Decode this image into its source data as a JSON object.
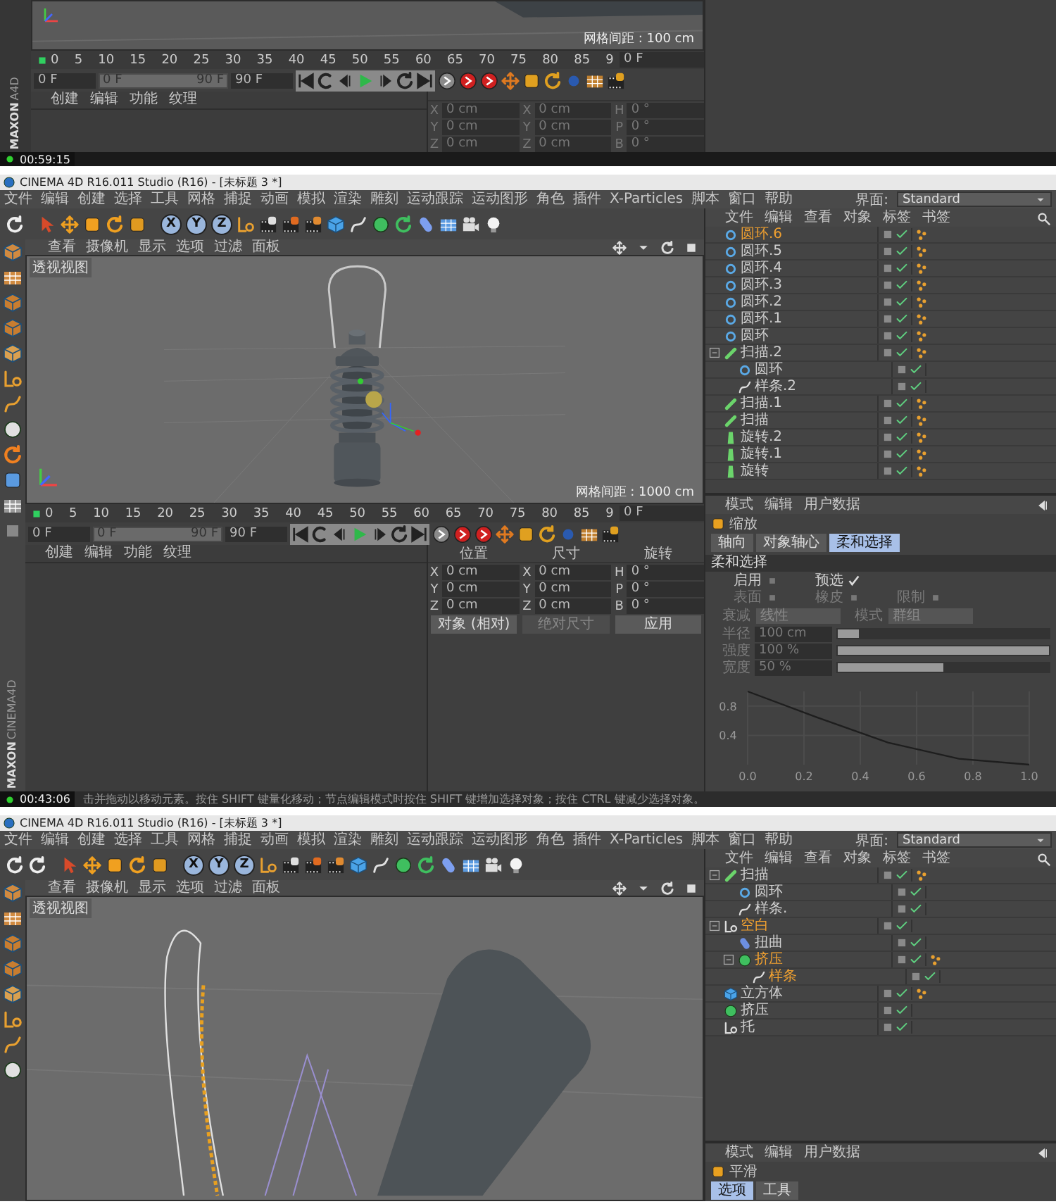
{
  "top_fragment": {
    "viewport": {
      "grid_spacing": "网格间距 : 100 cm"
    },
    "brand": {
      "maker": "MAXON",
      "product": "A4D"
    },
    "timeline": {
      "ruler": [
        "0",
        "5",
        "10",
        "15",
        "20",
        "25",
        "30",
        "35",
        "40",
        "45",
        "50",
        "55",
        "60",
        "65",
        "70",
        "75",
        "80",
        "85",
        "9"
      ],
      "current_frame": "0 F",
      "start_field": "0 F",
      "range": {
        "start": "0 F",
        "end": "90 F",
        "level": 1
      },
      "end_field": "90 F"
    },
    "material_menu": [
      "创建",
      "编辑",
      "功能",
      "纹理"
    ],
    "coords": {
      "disabled": true,
      "rows": [
        {
          "axis": "X",
          "pos": "0 cm",
          "size_axis": "X",
          "size": "0 cm",
          "rot_axis": "H",
          "rot": "0 °"
        },
        {
          "axis": "Y",
          "pos": "0 cm",
          "size_axis": "Y",
          "size": "0 cm",
          "rot_axis": "P",
          "rot": "0 °"
        },
        {
          "axis": "Z",
          "pos": "0 cm",
          "size_axis": "Z",
          "size": "0 cm",
          "rot_axis": "B",
          "rot": "0 °"
        }
      ]
    },
    "timer": "00:59:15"
  },
  "main_window": {
    "title": "CINEMA 4D R16.011 Studio (R16) - [未标题 3 *]",
    "menu": [
      "文件",
      "编辑",
      "创建",
      "选择",
      "工具",
      "网格",
      "捕捉",
      "动画",
      "模拟",
      "渲染",
      "雕刻",
      "运动跟踪",
      "运动图形",
      "角色",
      "插件",
      "X-Particles",
      "脚本",
      "窗口",
      "帮助"
    ],
    "layout_label": "界面:",
    "layout_value": "Standard",
    "axis_toggles": [
      "X",
      "Y",
      "Z"
    ],
    "viewport": {
      "menu": [
        "查看",
        "摄像机",
        "显示",
        "选项",
        "过滤",
        "面板"
      ],
      "label": "透视视图",
      "grid_spacing": "网格间距 : 1000 cm"
    },
    "brand": {
      "maker": "MAXON",
      "product": "CINEMA4D"
    },
    "timeline": {
      "ruler": [
        "0",
        "5",
        "10",
        "15",
        "20",
        "25",
        "30",
        "35",
        "40",
        "45",
        "50",
        "55",
        "60",
        "65",
        "70",
        "75",
        "80",
        "85",
        "9"
      ],
      "current_frame": "0 F",
      "start_field": "0 F",
      "range": {
        "start": "0 F",
        "end": "90 F",
        "level": 1
      },
      "end_field": "90 F"
    },
    "material_menu": [
      "创建",
      "编辑",
      "功能",
      "纹理"
    ],
    "coords": {
      "disabled": false,
      "headers": [
        "位置",
        "尺寸",
        "旋转"
      ],
      "rows": [
        {
          "axis": "X",
          "pos": "0 cm",
          "size_axis": "X",
          "size": "0 cm",
          "rot_axis": "H",
          "rot": "0 °"
        },
        {
          "axis": "Y",
          "pos": "0 cm",
          "size_axis": "Y",
          "size": "0 cm",
          "rot_axis": "P",
          "rot": "0 °"
        },
        {
          "axis": "Z",
          "pos": "0 cm",
          "size_axis": "Z",
          "size": "0 cm",
          "rot_axis": "B",
          "rot": "0 °"
        }
      ],
      "mode": "对象 (相对)",
      "size_mode": "绝对尺寸",
      "apply": "应用"
    },
    "objects": {
      "menu": [
        "文件",
        "编辑",
        "查看",
        "对象",
        "标签",
        "书签"
      ],
      "items": [
        {
          "name": "圆环.6",
          "kind": "circle",
          "selected": true,
          "tagged": true
        },
        {
          "name": "圆环.5",
          "kind": "circle",
          "selected": false,
          "tagged": true
        },
        {
          "name": "圆环.4",
          "kind": "circle",
          "selected": false,
          "tagged": true
        },
        {
          "name": "圆环.3",
          "kind": "circle",
          "selected": false,
          "tagged": true
        },
        {
          "name": "圆环.2",
          "kind": "circle",
          "selected": false,
          "tagged": true
        },
        {
          "name": "圆环.1",
          "kind": "circle",
          "selected": false,
          "tagged": true
        },
        {
          "name": "圆环",
          "kind": "circle",
          "selected": false,
          "tagged": true
        },
        {
          "name": "扫描.2",
          "kind": "sweep",
          "selected": false,
          "tagged": true,
          "children": [
            {
              "name": "圆环",
              "kind": "circle",
              "selected": false,
              "tagged": false
            },
            {
              "name": "样条.2",
              "kind": "spline",
              "selected": false,
              "tagged": false
            }
          ]
        },
        {
          "name": "扫描.1",
          "kind": "sweep",
          "selected": false,
          "tagged": true
        },
        {
          "name": "扫描",
          "kind": "sweep",
          "selected": false,
          "tagged": true
        },
        {
          "name": "旋转.2",
          "kind": "lathe",
          "selected": false,
          "tagged": true
        },
        {
          "name": "旋转.1",
          "kind": "lathe",
          "selected": false,
          "tagged": true
        },
        {
          "name": "旋转",
          "kind": "lathe",
          "selected": false,
          "tagged": true
        }
      ]
    },
    "attributes": {
      "menu": [
        "模式",
        "编辑",
        "用户数据"
      ],
      "object": "缩放",
      "tabs": [
        {
          "label": "轴向",
          "selected": false
        },
        {
          "label": "对象轴心",
          "selected": false
        },
        {
          "label": "柔和选择",
          "selected": true
        }
      ],
      "section": "柔和选择",
      "check_rows": [
        [
          {
            "label": "启用",
            "checked": false,
            "disabled": false
          },
          {
            "label": "预选",
            "checked": true,
            "disabled": false
          }
        ],
        [
          {
            "label": "表面",
            "checked": false,
            "disabled": true
          },
          {
            "label": "橡皮",
            "checked": false,
            "disabled": true
          },
          {
            "label": "限制",
            "checked": false,
            "disabled": true
          }
        ]
      ],
      "dropdowns": [
        {
          "label": "衰减",
          "value": "线性",
          "disabled": true
        },
        {
          "label": "模式",
          "value": "群组",
          "disabled": true
        }
      ],
      "sliders": [
        {
          "label": "半径",
          "value": "100 cm",
          "level": 0.1,
          "disabled": true
        },
        {
          "label": "强度",
          "value": "100 %",
          "level": 1,
          "disabled": true
        },
        {
          "label": "宽度",
          "value": "50 %",
          "level": 0.5,
          "disabled": true
        }
      ],
      "chart_data": {
        "type": "line",
        "x": [
          0,
          0.25,
          0.5,
          0.75,
          1
        ],
        "values": [
          1,
          0.64,
          0.3,
          0.08,
          0
        ],
        "xlim": [
          0,
          1
        ],
        "ylim": [
          0,
          1
        ],
        "xticks": [
          {
            "value": 0,
            "label": "0.0"
          },
          {
            "value": 0.2,
            "label": "0.2"
          },
          {
            "value": 0.4,
            "label": "0.4"
          },
          {
            "value": 0.6,
            "label": "0.6"
          },
          {
            "value": 0.8,
            "label": "0.8"
          },
          {
            "value": 1,
            "label": "1.0"
          }
        ],
        "yticks": [
          0.4,
          0.8
        ],
        "grid": true
      }
    },
    "status": "击并拖动以移动元素。按住 SHIFT 键量化移动；节点编辑模式时按住 SHIFT 键增加选择对象；按住 CTRL 键减少选择对象。",
    "timer": "00:43:06"
  },
  "second_window": {
    "title": "CINEMA 4D R16.011 Studio (R16) - [未标题 3 *]",
    "menu": [
      "文件",
      "编辑",
      "创建",
      "选择",
      "工具",
      "网格",
      "捕捉",
      "动画",
      "模拟",
      "渲染",
      "雕刻",
      "运动跟踪",
      "运动图形",
      "角色",
      "插件",
      "X-Particles",
      "脚本",
      "窗口",
      "帮助"
    ],
    "layout_label": "界面:",
    "layout_value": "Standard",
    "axis_toggles": [
      "X",
      "Y",
      "Z"
    ],
    "viewport": {
      "menu": [
        "查看",
        "摄像机",
        "显示",
        "选项",
        "过滤",
        "面板"
      ],
      "label": "透视视图"
    },
    "objects": {
      "menu": [
        "文件",
        "编辑",
        "查看",
        "对象",
        "标签",
        "书签"
      ],
      "items": [
        {
          "name": "扫描",
          "kind": "sweep",
          "selected": false,
          "tagged": true,
          "children": [
            {
              "name": "圆环",
              "kind": "circle",
              "selected": false,
              "tagged": false
            },
            {
              "name": "样条.",
              "kind": "spline",
              "selected": false,
              "tagged": false
            }
          ]
        },
        {
          "name": "空白",
          "kind": "null",
          "selected": true,
          "tagged": false,
          "children": [
            {
              "name": "扭曲",
              "kind": "deformer",
              "selected": false,
              "tagged": false
            },
            {
              "name": "挤压",
              "kind": "extrude",
              "selected": true,
              "tagged": true,
              "children": [
                {
                  "name": "样条",
                  "kind": "spline",
                  "selected": true,
                  "tagged": false
                }
              ]
            }
          ]
        },
        {
          "name": "立方体",
          "kind": "cube",
          "selected": false,
          "tagged": true
        },
        {
          "name": "挤压",
          "kind": "extrude",
          "selected": false,
          "tagged": false
        },
        {
          "name": "托",
          "kind": "null",
          "selected": false,
          "tagged": false
        }
      ]
    },
    "attributes": {
      "menu": [
        "模式",
        "编辑",
        "用户数据"
      ],
      "object": "平滑",
      "tabs": [
        {
          "label": "选项",
          "selected": true
        },
        {
          "label": "工具",
          "selected": false
        }
      ]
    }
  }
}
